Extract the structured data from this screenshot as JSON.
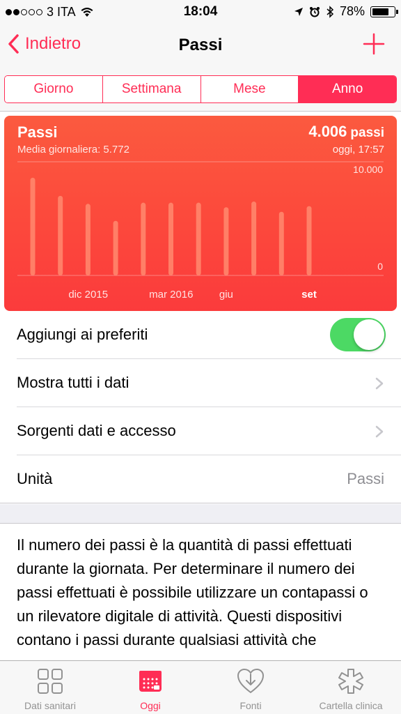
{
  "status_bar": {
    "carrier": "3 ITA",
    "time": "18:04",
    "battery": "78%",
    "battery_level": 0.78,
    "signal_bars_filled": 2,
    "signal_bars_total": 5
  },
  "nav": {
    "back_label": "Indietro",
    "title": "Passi"
  },
  "segments": [
    {
      "label": "Giorno",
      "active": false
    },
    {
      "label": "Settimana",
      "active": false
    },
    {
      "label": "Mese",
      "active": false
    },
    {
      "label": "Anno",
      "active": true
    }
  ],
  "chart_card": {
    "title": "Passi",
    "subtitle": "Media giornaliera: 5.772",
    "value": "4.006",
    "value_unit": "passi",
    "time": "oggi, 17:57"
  },
  "chart_data": {
    "type": "bar",
    "title": "Passi",
    "ylim": [
      0,
      10000
    ],
    "y_tick_labels": [
      "10.000",
      "0"
    ],
    "x_tick_labels": [
      {
        "label": "dic 2015",
        "index": 1,
        "bold": false
      },
      {
        "label": "mar 2016",
        "index": 4,
        "bold": false
      },
      {
        "label": "giu",
        "index": 7,
        "bold": false
      },
      {
        "label": "set",
        "index": 10,
        "bold": true
      }
    ],
    "values": [
      8600,
      7000,
      6300,
      4800,
      6400,
      6400,
      6400,
      6000,
      6500,
      5600,
      6100
    ],
    "grid": true,
    "bar_color": "#ff8a6e",
    "background_color": "#fb4a3c"
  },
  "rows": [
    {
      "label": "Aggiungi ai preferiti",
      "type": "toggle",
      "on": true
    },
    {
      "label": "Mostra tutti i dati",
      "type": "disclosure"
    },
    {
      "label": "Sorgenti dati e accesso",
      "type": "disclosure"
    },
    {
      "label": "Unità",
      "type": "value",
      "value": "Passi"
    }
  ],
  "description": "Il numero dei passi è la quantità di passi effettuati durante la giornata. Per determinare il numero dei passi effettuati è possibile utilizzare un contapassi o un rilevatore digitale di attività. Questi dispositivi contano i passi durante qualsiasi attività che",
  "tab_bar": [
    {
      "label": "Dati sanitari",
      "icon": "grid-icon",
      "active": false
    },
    {
      "label": "Oggi",
      "icon": "calendar-icon",
      "active": true
    },
    {
      "label": "Fonti",
      "icon": "heart-download-icon",
      "active": false
    },
    {
      "label": "Cartella clinica",
      "icon": "medical-star-icon",
      "active": false
    }
  ],
  "colors": {
    "accent": "#ff2d55",
    "toggle_on": "#4cd964",
    "secondary_text": "#8e8e93"
  }
}
